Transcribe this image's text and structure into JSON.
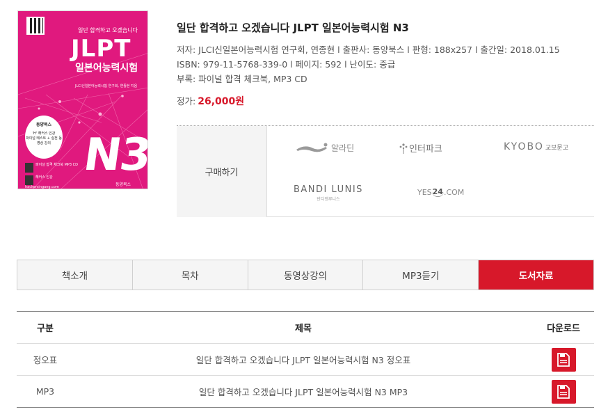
{
  "book": {
    "title": "일단 합격하고 오겠습니다 JLPT 일본어능력시험 N3",
    "meta_line1": "저자: JLCI신일본어능력시험 연구회, 연종현 l 출판사: 동양북스 l 판형: 188x257 l 출간일: 2018.01.15",
    "meta_line2": "ISBN: 979-11-5768-339-0 l 페이지: 592 l 난이도: 중급",
    "meta_line3": "부록: 파이널 합격 체크북, MP3 CD",
    "price_label": "정가:",
    "price_value": "26,000원",
    "cover": {
      "slogan": "일단 합격하고 오겠습니다",
      "brand": "JLPT",
      "subtitle": "일본어능력시험",
      "authors": "JLCI신일본어능력시험 연구회, 연종현 지음",
      "badge_line1": "동양북스",
      "badge_line2": "'H' 해커스 인강",
      "badge_line3": "파이널 테스트 + 실전 동영상 강의",
      "level": "N3",
      "box1": "파이널 합격 체크북 MP3 CD",
      "box2": "해커스 인강 hackersingang.com",
      "publisher": "동양북스",
      "accent": "#e0197e"
    }
  },
  "purchase": {
    "label": "구매하기",
    "stores": {
      "aladin": "알라딘",
      "interpark": "인터파크",
      "kyobo_main": "KYOBO",
      "kyobo_sub": "교보문고",
      "bandi_main": "BANDI LUNIS",
      "bandi_sub": "반디앤루니스",
      "yes_prefix": "YES",
      "yes_num": "24",
      "yes_suffix": ".COM"
    }
  },
  "tabs": [
    {
      "label": "책소개"
    },
    {
      "label": "목차"
    },
    {
      "label": "동영상강의"
    },
    {
      "label": "MP3듣기"
    },
    {
      "label": "도서자료",
      "active": true
    }
  ],
  "table": {
    "headers": {
      "type": "구분",
      "title": "제목",
      "download": "다운로드"
    },
    "rows": [
      {
        "type": "정오표",
        "title": "일단 합격하고 오겠습니다 JLPT 일본어능력시험 N3 정오표"
      },
      {
        "type": "MP3",
        "title": "일단 합격하고 오겠습니다 JLPT 일본어능력시험 N3 MP3"
      }
    ]
  },
  "colors": {
    "accent": "#d7182a",
    "tab_bg": "#f5f5f5",
    "cover_pink": "#e0197e"
  }
}
